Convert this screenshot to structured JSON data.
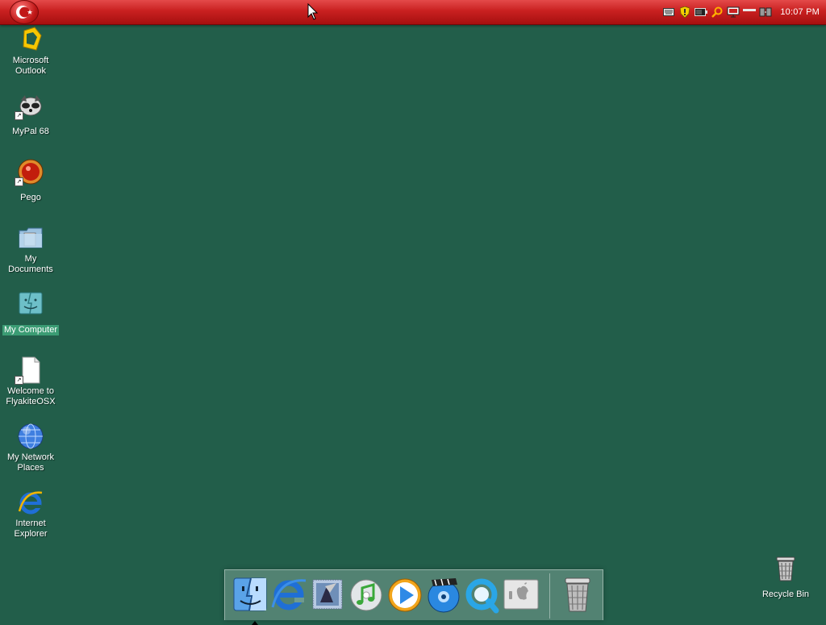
{
  "menubar": {
    "clock": "10:07 PM",
    "tray_icons": [
      "keyboard-icon",
      "shield-icon",
      "battery-icon",
      "search-icon",
      "monitor-icon",
      "minimize-icon",
      "network-icon"
    ]
  },
  "desktop": {
    "icons": [
      {
        "label": "Microsoft Outlook",
        "icon": "outlook-icon"
      },
      {
        "label": "MyPal 68",
        "icon": "mypal-icon"
      },
      {
        "label": "Pego",
        "icon": "pego-icon"
      },
      {
        "label": "My Documents",
        "icon": "documents-folder-icon"
      },
      {
        "label": "My Computer",
        "icon": "computer-icon",
        "selected": true
      },
      {
        "label": "Welcome to FlyakiteOSX",
        "icon": "document-icon"
      },
      {
        "label": "My Network Places",
        "icon": "network-places-icon"
      },
      {
        "label": "Internet Explorer",
        "icon": "internet-explorer-icon"
      },
      {
        "label": "Recycle Bin",
        "icon": "recycle-bin-icon"
      }
    ]
  },
  "dock": {
    "items": [
      "finder-icon",
      "internet-explorer-icon",
      "mail-icon",
      "itunes-icon",
      "media-player-icon",
      "dvd-player-icon",
      "quicktime-icon",
      "system-preferences-icon",
      "trash-icon"
    ]
  },
  "colors": {
    "desktop_bg": "#225e4a",
    "menubar_red": "#c92020",
    "selection": "#3b9c74"
  }
}
